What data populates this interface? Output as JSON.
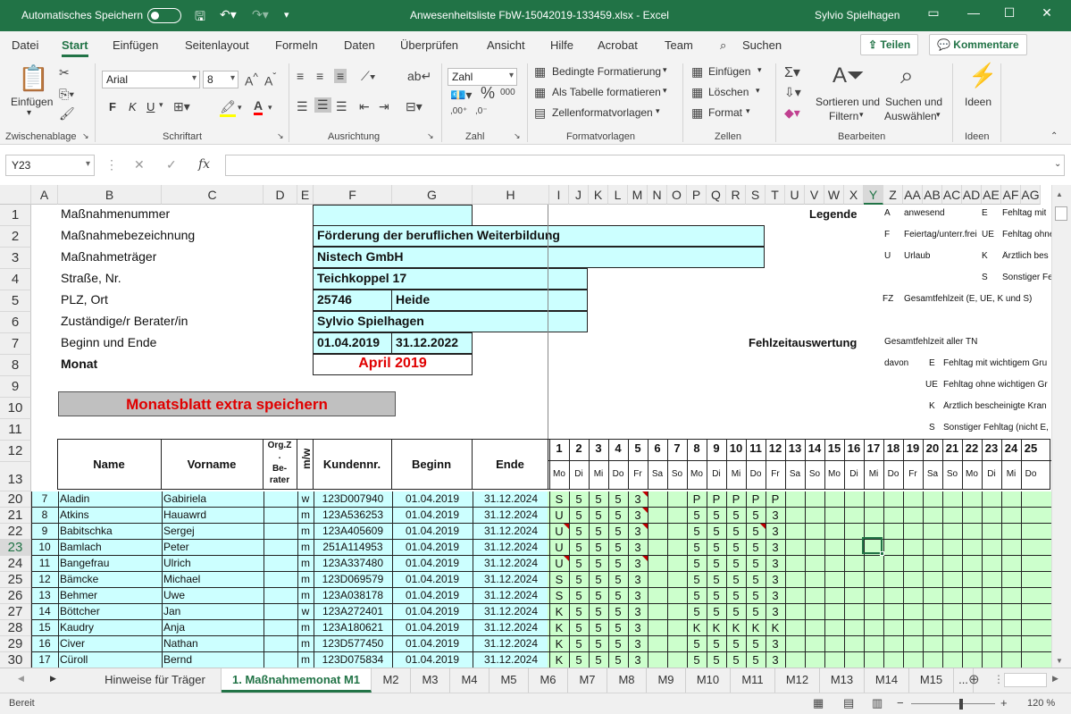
{
  "titlebar": {
    "autosave_label": "Automatisches Speichern",
    "filename": "Anwesenheitsliste FbW-15042019-133459.xlsx  -  Excel",
    "user": "Sylvio Spielhagen"
  },
  "menu": [
    "Datei",
    "Start",
    "Einfügen",
    "Seitenlayout",
    "Formeln",
    "Daten",
    "Überprüfen",
    "Ansicht",
    "Hilfe",
    "Acrobat",
    "Team"
  ],
  "search_label": "Suchen",
  "share_label": "Teilen",
  "comments_label": "Kommentare",
  "ribbon": {
    "paste": "Einfügen",
    "clipboard_group": "Zwischenablage",
    "font_name": "Arial",
    "font_size": "8",
    "bold": "F",
    "italic": "K",
    "underline": "U",
    "font_group": "Schriftart",
    "align_group": "Ausrichtung",
    "number_format": "Zahl",
    "number_group": "Zahl",
    "cond_format": "Bedingte Formatierung",
    "as_table": "Als Tabelle formatieren",
    "cell_styles": "Zellenformatvorlagen",
    "styles_group": "Formatvorlagen",
    "insert": "Einfügen",
    "delete": "Löschen",
    "format": "Format",
    "cells_group": "Zellen",
    "sort_filter": [
      "Sortieren und",
      "Filtern"
    ],
    "find_select": [
      "Suchen und",
      "Auswählen"
    ],
    "edit_group": "Bearbeiten",
    "ideas": "Ideen",
    "ideas_group": "Ideen"
  },
  "namebox": "Y23",
  "columns": [
    "A",
    "B",
    "C",
    "D",
    "E",
    "F",
    "G",
    "H",
    "I",
    "J",
    "K",
    "L",
    "M",
    "N",
    "O",
    "P",
    "Q",
    "R",
    "S",
    "T",
    "U",
    "V",
    "W",
    "X",
    "Y",
    "Z",
    "AA",
    "AB",
    "AC",
    "AD",
    "AE",
    "AF",
    "AG"
  ],
  "header_rows": [
    "1",
    "2",
    "3",
    "4",
    "5",
    "6",
    "7",
    "8",
    "9",
    "10",
    "11",
    "12",
    "13"
  ],
  "info": {
    "labels": [
      "Maßnahmenummer",
      "Maßnahmebezeichnung",
      "Maßnahmeträger",
      "Straße, Nr.",
      "PLZ, Ort",
      "Zuständige/r Berater/in",
      "Beginn und Ende",
      "Monat"
    ],
    "bezeichnung": "Förderung der beruflichen Weiterbildung",
    "traeger": "Nistech GmbH",
    "strasse": "Teichkoppel 17",
    "plz": "25746",
    "ort": "Heide",
    "berater": "Sylvio Spielhagen",
    "beginn": "01.04.2019",
    "ende": "31.12.2022",
    "monat": "April 2019"
  },
  "save_button": "Monatsblatt extra speichern",
  "legend": {
    "title": "Legende",
    "A_code": "A",
    "A_text": "anwesend",
    "E_code": "E",
    "E_text": "Fehltag mit",
    "F_code": "F",
    "F_text": "Feiertag/unterr.frei",
    "UE_code": "UE",
    "UE_text": "Fehltag ohne",
    "U_code": "U",
    "U_text": "Urlaub",
    "K_code": "K",
    "K_text": "Ärztlich bes",
    "S_code": "S",
    "S_text": "Sonstiger Fe",
    "FZ_code": "FZ",
    "FZ_text": "Gesamtfehlzeit (E, UE, K und S)"
  },
  "fehlzeit": {
    "title": "Fehlzeitauswertung",
    "gesamt": "Gesamtfehlzeit aller TN",
    "davon": "davon",
    "E_code": "E",
    "E_text": "Fehltag mit wichtigem Gru",
    "UE_code": "UE",
    "UE_text": "Fehltag ohne wichtigen Gr",
    "K_code": "K",
    "K_text": "Ärztlich bescheinigte Kran",
    "S_code": "S",
    "S_text": "Sonstiger Fehltag (nicht E,"
  },
  "table_header": {
    "name": "Name",
    "vorname": "Vorname",
    "orgz": [
      "Org.Z",
      ".",
      "Be-",
      "rater"
    ],
    "mw": "m/w",
    "kundennr": "Kundennr.",
    "beginn": "Beginn",
    "ende": "Ende"
  },
  "days": [
    "1",
    "2",
    "3",
    "4",
    "5",
    "6",
    "7",
    "8",
    "9",
    "10",
    "11",
    "12",
    "13",
    "14",
    "15",
    "16",
    "17",
    "18",
    "19",
    "20",
    "21",
    "22",
    "23",
    "24",
    "25",
    "26"
  ],
  "weekdays": [
    "Mo",
    "Di",
    "Mi",
    "Do",
    "Fr",
    "Sa",
    "So",
    "Mo",
    "Di",
    "Mi",
    "Do",
    "Fr",
    "Sa",
    "So",
    "Mo",
    "Di",
    "Mi",
    "Do",
    "Fr",
    "Sa",
    "So",
    "Mo",
    "Di",
    "Mi",
    "Do",
    "Fr"
  ],
  "rows": [
    {
      "row": "20",
      "nr": "7",
      "name": "Aladin",
      "vorname": "Gabiriela",
      "mw": "w",
      "kd": "123D007940",
      "beginn": "01.04.2019",
      "ende": "31.12.2024",
      "d": [
        "S",
        "5",
        "5",
        "5",
        "3",
        "",
        "",
        "P",
        "P",
        "P",
        "P",
        "P"
      ]
    },
    {
      "row": "21",
      "nr": "8",
      "name": "Atkins",
      "vorname": "Hauawrd",
      "mw": "m",
      "kd": "123A536253",
      "beginn": "01.04.2019",
      "ende": "31.12.2024",
      "d": [
        "U",
        "5",
        "5",
        "5",
        "3",
        "",
        "",
        "5",
        "5",
        "5",
        "5",
        "3"
      ]
    },
    {
      "row": "22",
      "nr": "9",
      "name": "Babitschka",
      "vorname": "Sergej",
      "mw": "m",
      "kd": "123A405609",
      "beginn": "01.04.2019",
      "ende": "31.12.2024",
      "d": [
        "U",
        "5",
        "5",
        "5",
        "3",
        "",
        "",
        "5",
        "5",
        "5",
        "5",
        "3"
      ]
    },
    {
      "row": "23",
      "nr": "10",
      "name": "Bamlach",
      "vorname": "Peter",
      "mw": "m",
      "kd": "251A114953",
      "beginn": "01.04.2019",
      "ende": "31.12.2024",
      "d": [
        "U",
        "5",
        "5",
        "5",
        "3",
        "",
        "",
        "5",
        "5",
        "5",
        "5",
        "3"
      ]
    },
    {
      "row": "24",
      "nr": "11",
      "name": "Bangefrau",
      "vorname": "Ulrich",
      "mw": "m",
      "kd": "123A337480",
      "beginn": "01.04.2019",
      "ende": "31.12.2024",
      "d": [
        "U",
        "5",
        "5",
        "5",
        "3",
        "",
        "",
        "5",
        "5",
        "5",
        "5",
        "3"
      ]
    },
    {
      "row": "25",
      "nr": "12",
      "name": "Bämcke",
      "vorname": "Michael",
      "mw": "m",
      "kd": "123D069579",
      "beginn": "01.04.2019",
      "ende": "31.12.2024",
      "d": [
        "S",
        "5",
        "5",
        "5",
        "3",
        "",
        "",
        "5",
        "5",
        "5",
        "5",
        "3"
      ]
    },
    {
      "row": "26",
      "nr": "13",
      "name": "Behmer",
      "vorname": "Uwe",
      "mw": "m",
      "kd": "123A038178",
      "beginn": "01.04.2019",
      "ende": "31.12.2024",
      "d": [
        "S",
        "5",
        "5",
        "5",
        "3",
        "",
        "",
        "5",
        "5",
        "5",
        "5",
        "3"
      ]
    },
    {
      "row": "27",
      "nr": "14",
      "name": "Böttcher",
      "vorname": "Jan",
      "mw": "w",
      "kd": "123A272401",
      "beginn": "01.04.2019",
      "ende": "31.12.2024",
      "d": [
        "K",
        "5",
        "5",
        "5",
        "3",
        "",
        "",
        "5",
        "5",
        "5",
        "5",
        "3"
      ]
    },
    {
      "row": "28",
      "nr": "15",
      "name": "Kaudry",
      "vorname": "Anja",
      "mw": "m",
      "kd": "123A180621",
      "beginn": "01.04.2019",
      "ende": "31.12.2024",
      "d": [
        "K",
        "5",
        "5",
        "5",
        "3",
        "",
        "",
        "K",
        "K",
        "K",
        "K",
        "K"
      ]
    },
    {
      "row": "29",
      "nr": "16",
      "name": "Civer",
      "vorname": "Nathan",
      "mw": "m",
      "kd": "123D577450",
      "beginn": "01.04.2019",
      "ende": "31.12.2024",
      "d": [
        "K",
        "5",
        "5",
        "5",
        "3",
        "",
        "",
        "5",
        "5",
        "5",
        "5",
        "3"
      ]
    },
    {
      "row": "30",
      "nr": "17",
      "name": "Cüroll",
      "vorname": "Bernd",
      "mw": "m",
      "kd": "123D075834",
      "beginn": "01.04.2019",
      "ende": "31.12.2024",
      "d": [
        "K",
        "5",
        "5",
        "5",
        "3",
        "",
        "",
        "5",
        "5",
        "5",
        "5",
        "3"
      ]
    }
  ],
  "tabs": [
    "Hinweise für Träger",
    "1. Maßnahmemonat M1",
    "M2",
    "M3",
    "M4",
    "M5",
    "M6",
    "M7",
    "M8",
    "M9",
    "M10",
    "M11",
    "M12",
    "M13",
    "M14",
    "M15",
    "..."
  ],
  "status": {
    "ready": "Bereit",
    "zoom": "120 %"
  }
}
